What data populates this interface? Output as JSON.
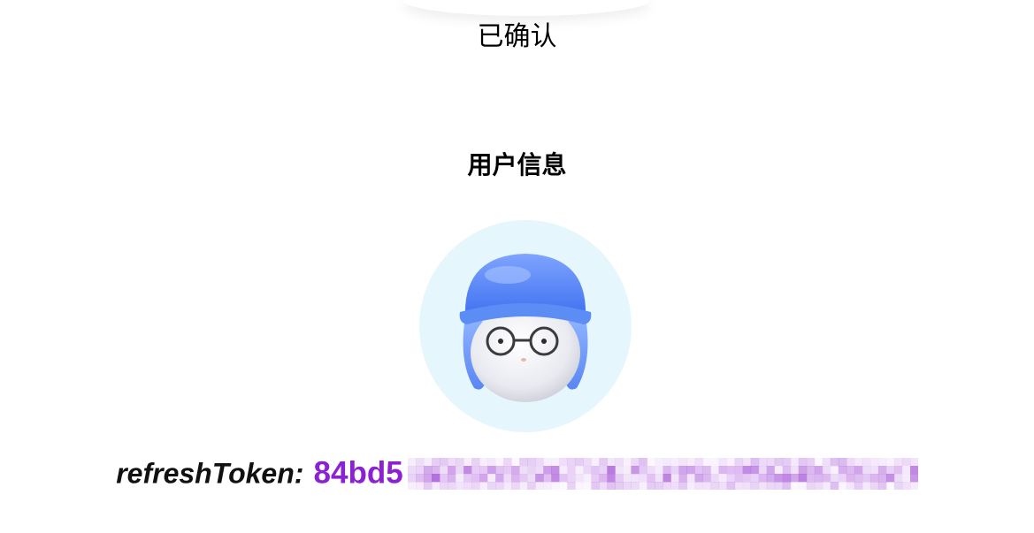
{
  "status": {
    "text": "已确认"
  },
  "user_info": {
    "title": "用户信息",
    "avatar_icon": "avatar-cap-glasses-icon",
    "avatar_bg_color": "#e6f6fd",
    "refresh_token_label": "refreshToken:",
    "refresh_token_visible_prefix": "84bd5",
    "refresh_token_obscured": "pixelated-redaction",
    "token_color": "#8a22d1"
  }
}
